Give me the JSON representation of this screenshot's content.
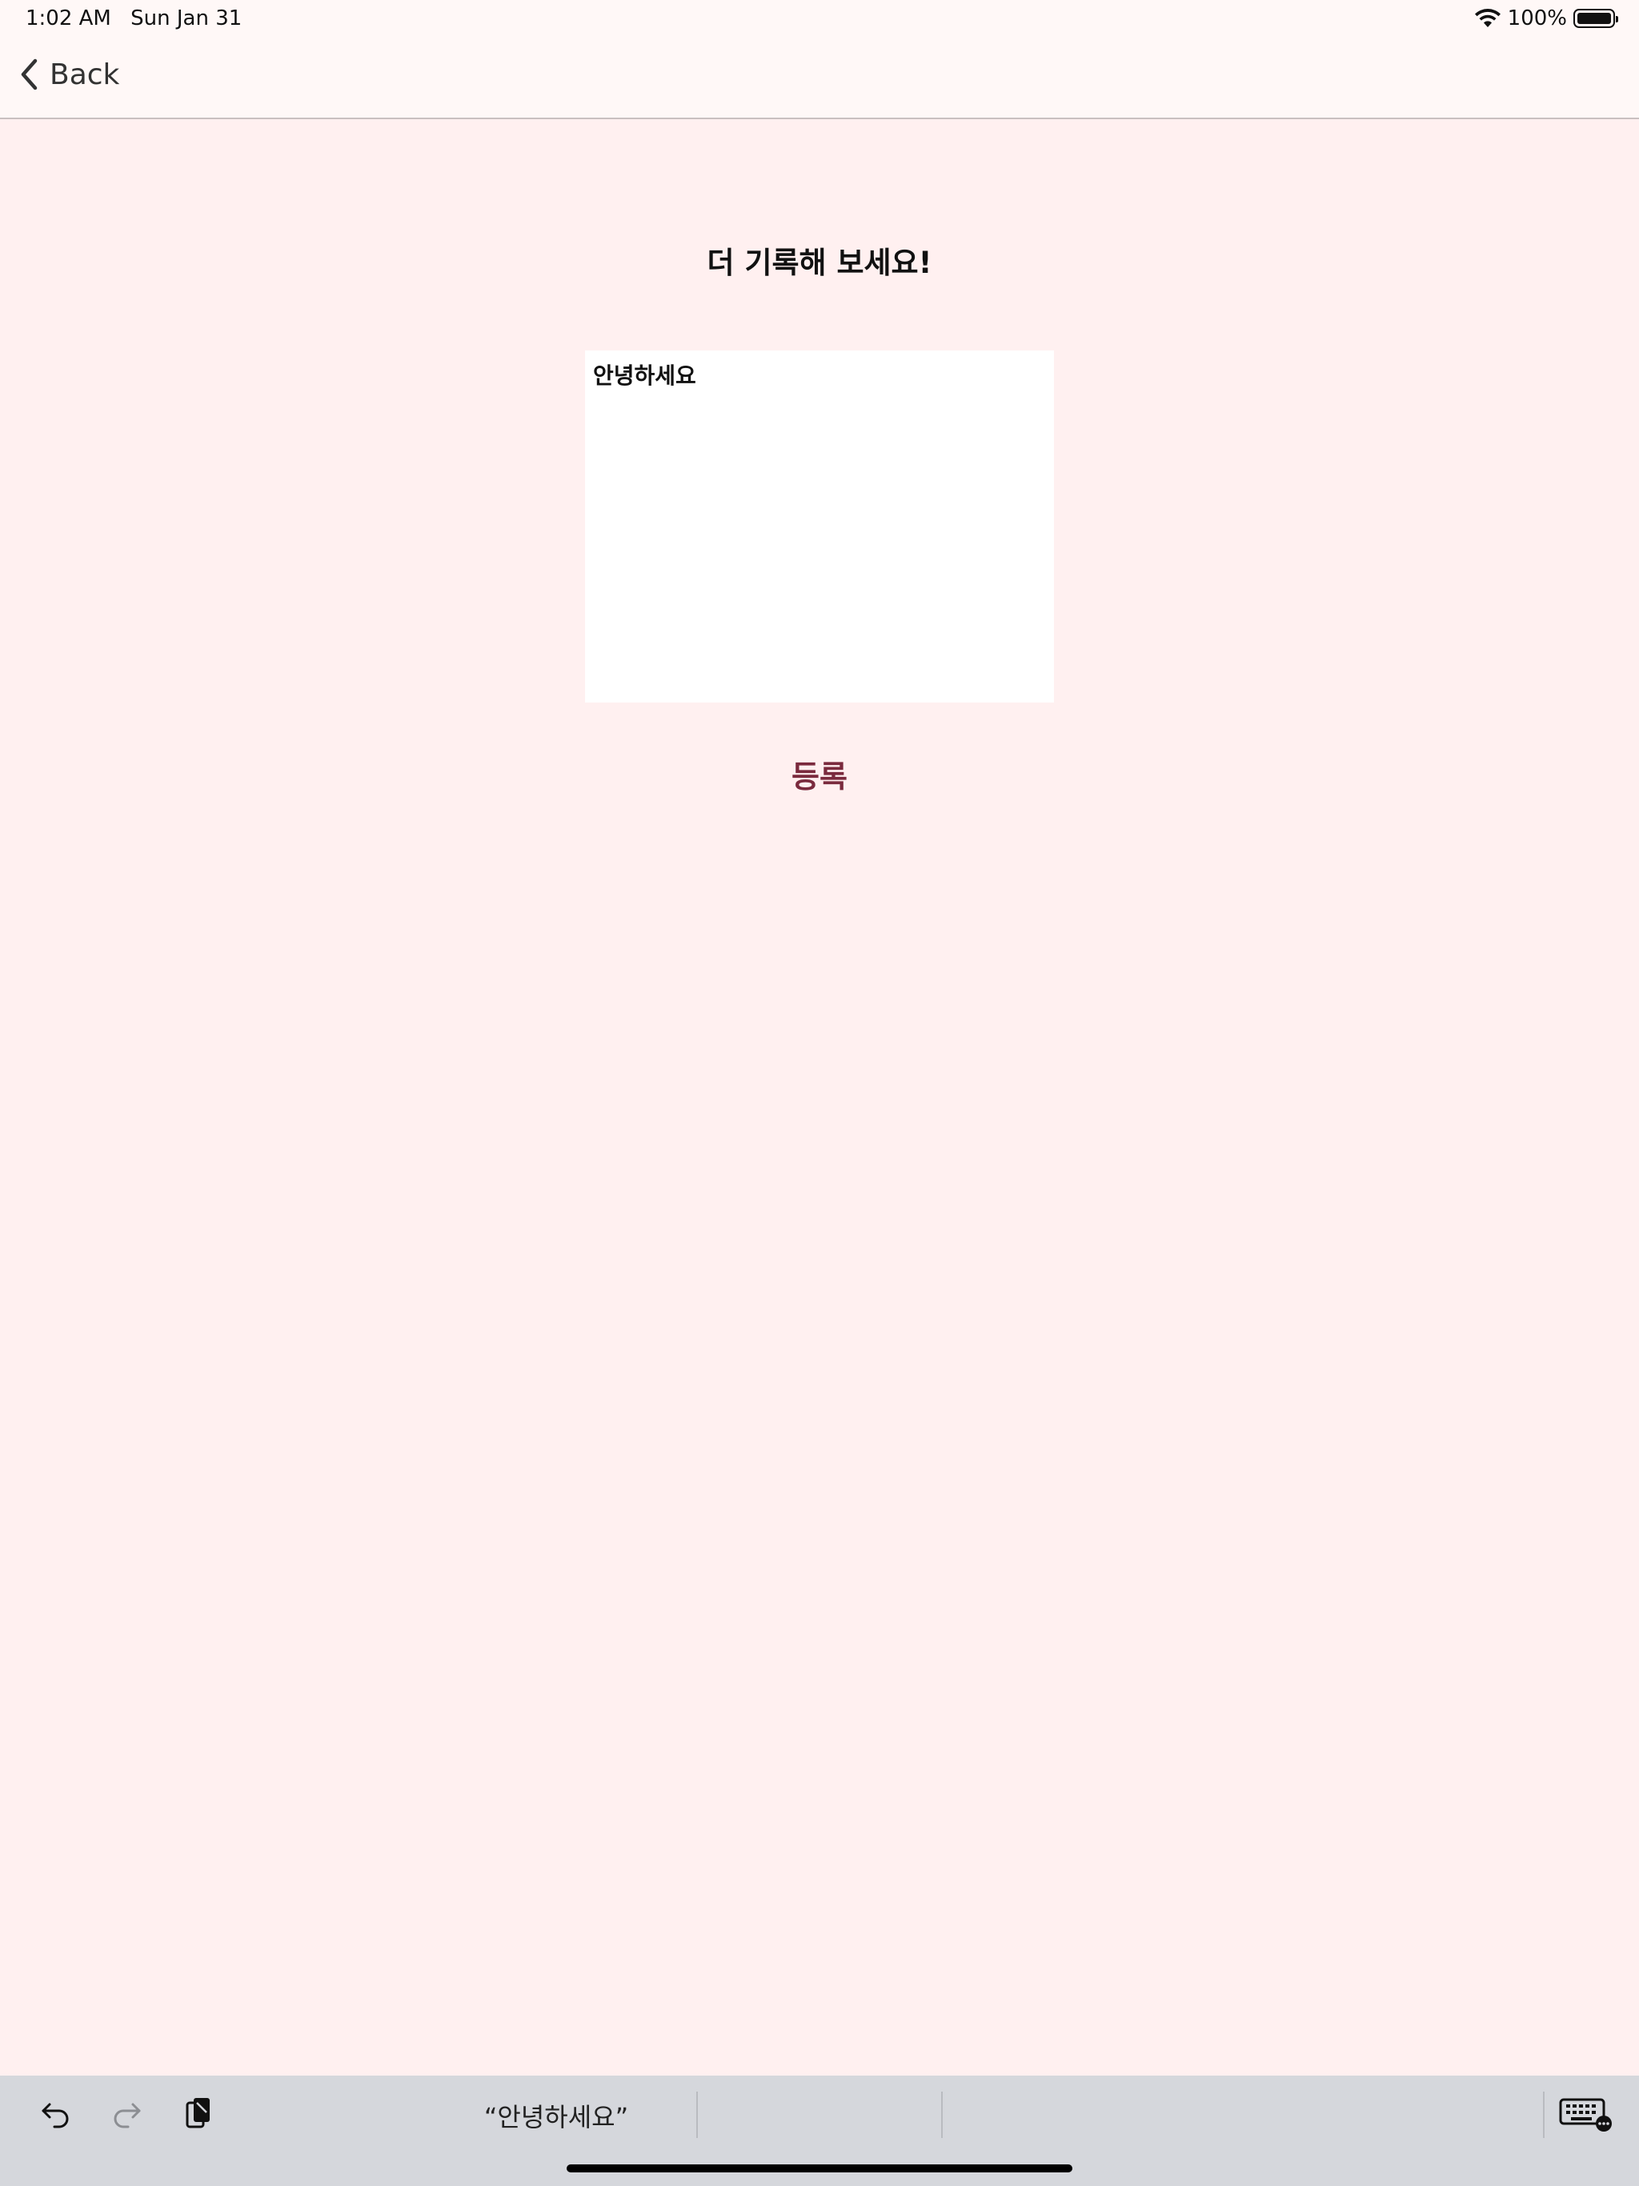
{
  "status_bar": {
    "time": "1:02 AM",
    "date": "Sun Jan 31",
    "battery": "100%",
    "battery_level": 1.0
  },
  "nav": {
    "back_label": "Back"
  },
  "main": {
    "title": "더 기록해 보세요!",
    "textarea_value": "안녕하세요",
    "register_label": "등록"
  },
  "shortcut_bar": {
    "suggestion": "“안녕하세요”",
    "icons": [
      "undo-icon",
      "redo-icon",
      "paste-icon",
      "keyboard-icon"
    ]
  },
  "colors": {
    "background": "#fff0f0",
    "accent": "#7a2a3d",
    "keyboard_bar": "#d5d7dc"
  }
}
